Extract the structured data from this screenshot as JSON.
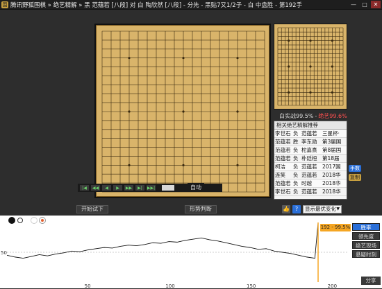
{
  "window": {
    "title": "腾讯野狐围棋 » 绝艺精解 » 黑 范蕴若 [八段] 对 白 陶欣然 [八段] - 分先 - 黑贴7又1/2子 - 白 中盘胜 - 第192手",
    "app_icon_glyph": "围"
  },
  "winrate": {
    "actual_label": "白实战99.5%",
    "separator": "-",
    "ai_label": "绝艺99.6%"
  },
  "kifu": {
    "header": "相关绝艺精解推荐",
    "rows": [
      {
        "player": "李世石",
        "result": "负",
        "opponent": "范蕴若",
        "event": "三星杯·"
      },
      {
        "player": "范蕴若",
        "result": "胜",
        "opponent": "李东勋",
        "event": "第3届国"
      },
      {
        "player": "范蕴若",
        "result": "负",
        "opponent": "柁嘉熹",
        "event": "第8届国"
      },
      {
        "player": "范蕴若",
        "result": "负",
        "opponent": "朴廷桓",
        "event": "第18届"
      },
      {
        "player": "柯洁",
        "result": "负",
        "opponent": "范蕴若",
        "event": "2017国"
      },
      {
        "player": "连笑",
        "result": "负",
        "opponent": "范蕴若",
        "event": "2018华"
      },
      {
        "player": "范蕴若",
        "result": "负",
        "opponent": "时越",
        "event": "2018华"
      },
      {
        "player": "李世石",
        "result": "负",
        "opponent": "范蕴若",
        "event": "2018华"
      }
    ]
  },
  "side_buttons": {
    "jump": "手数",
    "alt": "复制"
  },
  "controls": {
    "first": "|◀",
    "prev10": "◀◀",
    "prev": "◀",
    "play": "▶",
    "next": "▶▶",
    "next10": "▶|",
    "last": "▶▶|",
    "autoplay": "自动"
  },
  "toolbar": {
    "start_trial": "开始试下",
    "judge": "形势判断",
    "thumb": "👍",
    "help": "?",
    "select_value": "显示最优变化"
  },
  "graph": {
    "tooltip": "192 - 99.5%",
    "y_tick": "50",
    "x_ticks": [
      "50",
      "100",
      "150",
      "200"
    ],
    "buttons": [
      "胜率",
      "领先度",
      "绝艺现场",
      "悬疑时刻"
    ],
    "bottom_button": "分享",
    "colors": {
      "line": "#111111",
      "cursor": "#f5a623",
      "accent": "#2a6fd8"
    }
  },
  "chart_data": {
    "type": "line",
    "title": "",
    "xlabel": "",
    "ylabel": "",
    "xlim": [
      0,
      210
    ],
    "ylim": [
      0,
      100
    ],
    "x_ticks": [
      50,
      100,
      150,
      200
    ],
    "y_ticks": [
      50
    ],
    "series": [
      {
        "x": [
          0,
          5,
          10,
          15,
          20,
          25,
          30,
          35,
          40,
          45,
          50,
          55,
          60,
          65,
          70,
          75,
          80,
          85,
          90,
          95,
          100,
          105,
          110,
          115,
          120,
          125,
          130,
          135,
          140,
          145,
          150,
          155,
          160,
          165,
          170,
          175,
          180,
          185,
          190,
          192
        ],
        "y": [
          45,
          42,
          40,
          43,
          46,
          44,
          47,
          49,
          52,
          51,
          54,
          56,
          58,
          57,
          60,
          62,
          61,
          63,
          66,
          65,
          68,
          67,
          70,
          72,
          74,
          71,
          69,
          66,
          63,
          60,
          58,
          55,
          56,
          52,
          50,
          48,
          45,
          42,
          40,
          99.5
        ]
      }
    ],
    "current_move": 192,
    "current_value": 99.5
  }
}
